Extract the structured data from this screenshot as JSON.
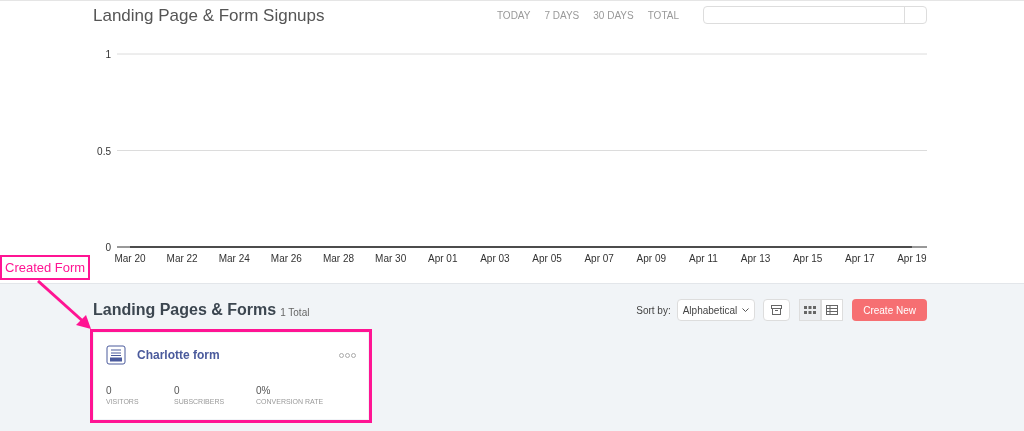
{
  "chart_panel": {
    "title": "Landing Page & Form Signups",
    "ranges": [
      {
        "label": "TODAY",
        "selected": false
      },
      {
        "label": "7 DAYS",
        "selected": false
      },
      {
        "label": "30 DAYS",
        "selected": false
      },
      {
        "label": "TOTAL",
        "selected": false
      }
    ],
    "chart_data": {
      "type": "line",
      "categories": [
        "Mar 20",
        "Mar 22",
        "Mar 24",
        "Mar 26",
        "Mar 28",
        "Mar 30",
        "Apr 01",
        "Apr 03",
        "Apr 05",
        "Apr 07",
        "Apr 09",
        "Apr 11",
        "Apr 13",
        "Apr 15",
        "Apr 17",
        "Apr 19"
      ],
      "values": [
        0,
        0,
        0,
        0,
        0,
        0,
        0,
        0,
        0,
        0,
        0,
        0,
        0,
        0,
        0,
        0
      ],
      "ylim": [
        0,
        1
      ],
      "yticks": [
        0,
        0.5,
        1
      ]
    }
  },
  "forms_panel": {
    "title": "Landing Pages & Forms",
    "count": "1 Total",
    "sort_label": "Sort by:",
    "sort_value": "Alphabetical",
    "views": [
      {
        "kind": "grid",
        "selected": true
      },
      {
        "kind": "list",
        "selected": false
      }
    ],
    "create_button": "Create New",
    "cards": [
      {
        "title": "Charlotte form",
        "stats": [
          {
            "value": "0",
            "label": "VISITORS"
          },
          {
            "value": "0",
            "label": "SUBSCRIBERS"
          },
          {
            "value": "0%",
            "label": "CONVERSION RATE"
          }
        ]
      }
    ]
  },
  "annotation": {
    "label": "Created Form"
  }
}
